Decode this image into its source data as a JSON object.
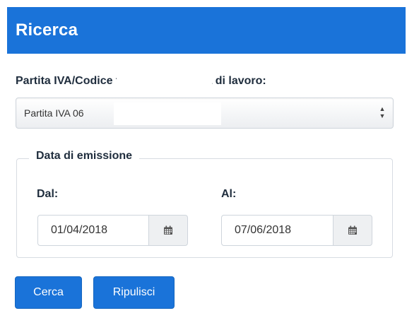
{
  "panel": {
    "title": "Ricerca"
  },
  "workspace_field": {
    "label": "Partita IVA/Codice fiscale dell'utenza di lavoro:",
    "selected_value": "Partita IVA 06"
  },
  "date_section": {
    "legend": "Data di emissione",
    "from": {
      "label": "Dal:",
      "value": "01/04/2018",
      "icon": "calendar-icon"
    },
    "to": {
      "label": "Al:",
      "value": "07/06/2018",
      "icon": "calendar-icon"
    }
  },
  "actions": {
    "search_label": "Cerca",
    "reset_label": "Ripulisci"
  },
  "colors": {
    "primary": "#1a73d9",
    "text": "#1f2d3d"
  }
}
